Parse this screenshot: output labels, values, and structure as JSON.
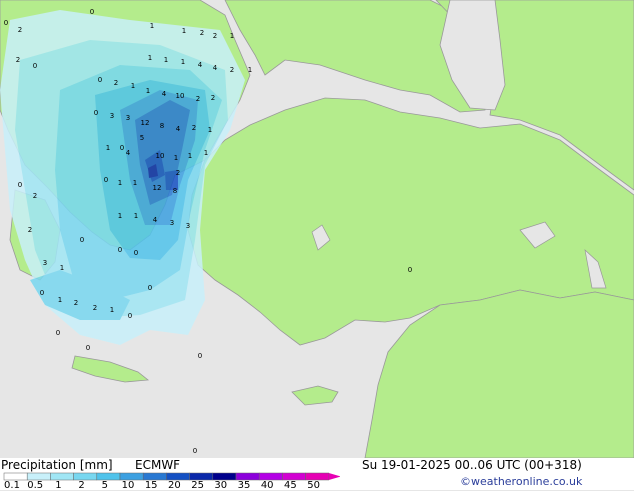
{
  "legend": {
    "title": "Precipitation [mm]",
    "model": "ECMWF",
    "ticks": [
      "0.1",
      "0.5",
      "1",
      "2",
      "5",
      "10",
      "15",
      "20",
      "25",
      "30",
      "35",
      "40",
      "45",
      "50"
    ],
    "colors": [
      "#ffffff",
      "#c8f0fa",
      "#a0e6f5",
      "#78d7f0",
      "#50c3eb",
      "#3ca0e1",
      "#2878d2",
      "#1450c3",
      "#0a28aa",
      "#00008c",
      "#8c00dc",
      "#b400e6",
      "#d200d2",
      "#e600b4"
    ]
  },
  "run": {
    "text": "Su 19-01-2025 00..06 UTC (00+318)"
  },
  "credit": {
    "text": "©weatheronline.co.uk"
  },
  "map_values": [
    "1",
    "1",
    "2",
    "2",
    "1",
    "0",
    "2",
    "0",
    "2",
    "0",
    "1",
    "1",
    "1",
    "4",
    "4",
    "2",
    "1",
    "0",
    "2",
    "1",
    "1",
    "4",
    "10",
    "2",
    "2",
    "8",
    "12",
    "2",
    "4",
    "1",
    "3",
    "3",
    "0",
    "5",
    "0",
    "1",
    "4",
    "10",
    "1",
    "1",
    "1",
    "2",
    "1",
    "12",
    "8",
    "0",
    "1",
    "0",
    "2",
    "1",
    "1",
    "4",
    "3",
    "3",
    "0",
    "2",
    "3",
    "1",
    "0",
    "0",
    "1",
    "0",
    "2",
    "2",
    "1",
    "0",
    "0",
    "0",
    "0",
    "0",
    "0",
    "0"
  ]
}
